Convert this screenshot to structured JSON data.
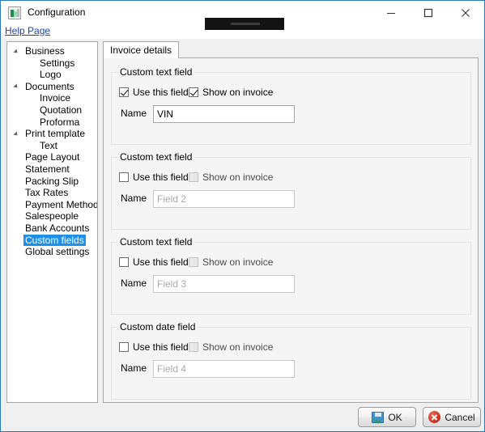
{
  "window": {
    "title": "Configuration",
    "icon": "app-image-icon",
    "border_color": "#2b79b7",
    "controls": {
      "minimize": "Minimize",
      "maximize": "Maximize",
      "close": "Close"
    },
    "redacted_region": true
  },
  "help": {
    "link_label": "Help Page",
    "link_color": "#1f3faa"
  },
  "sidebar": {
    "selection_color": "#1e90e8",
    "items": [
      {
        "label": "Business",
        "level": 0,
        "expander": true,
        "selected": false
      },
      {
        "label": "Settings",
        "level": 1,
        "expander": false,
        "selected": false
      },
      {
        "label": "Logo",
        "level": 1,
        "expander": false,
        "selected": false
      },
      {
        "label": "Documents",
        "level": 0,
        "expander": true,
        "selected": false
      },
      {
        "label": "Invoice",
        "level": 1,
        "expander": false,
        "selected": false
      },
      {
        "label": "Quotation",
        "level": 1,
        "expander": false,
        "selected": false
      },
      {
        "label": "Proforma",
        "level": 1,
        "expander": false,
        "selected": false
      },
      {
        "label": "Print template",
        "level": 0,
        "expander": true,
        "selected": false
      },
      {
        "label": "Text",
        "level": 1,
        "expander": false,
        "selected": false
      },
      {
        "label": "Page Layout",
        "level": 0,
        "expander": false,
        "selected": false
      },
      {
        "label": "Statement",
        "level": 0,
        "expander": false,
        "selected": false
      },
      {
        "label": "Packing Slip",
        "level": 0,
        "expander": false,
        "selected": false
      },
      {
        "label": "Tax Rates",
        "level": 0,
        "expander": false,
        "selected": false
      },
      {
        "label": "Payment Methods",
        "level": 0,
        "expander": false,
        "selected": false
      },
      {
        "label": "Salespeople",
        "level": 0,
        "expander": false,
        "selected": false
      },
      {
        "label": "Bank Accounts",
        "level": 0,
        "expander": false,
        "selected": false
      },
      {
        "label": "Custom fields",
        "level": 0,
        "expander": false,
        "selected": true
      },
      {
        "label": "Global settings",
        "level": 0,
        "expander": false,
        "selected": false
      }
    ]
  },
  "tabs": [
    {
      "label": "Invoice details",
      "selected": true
    }
  ],
  "groups": [
    {
      "title": "Custom text field",
      "use_field": {
        "label": "Use this field",
        "checked": true,
        "enabled": true
      },
      "show_on_invoice": {
        "label": "Show on invoice",
        "checked": true,
        "enabled": true
      },
      "name_label": "Name",
      "name_value": "VIN",
      "name_placeholder": ""
    },
    {
      "title": "Custom text field",
      "use_field": {
        "label": "Use this field",
        "checked": false,
        "enabled": true
      },
      "show_on_invoice": {
        "label": "Show on invoice",
        "checked": false,
        "enabled": false
      },
      "name_label": "Name",
      "name_value": "",
      "name_placeholder": "Field 2"
    },
    {
      "title": "Custom text field",
      "use_field": {
        "label": "Use this field",
        "checked": false,
        "enabled": true
      },
      "show_on_invoice": {
        "label": "Show on invoice",
        "checked": false,
        "enabled": false
      },
      "name_label": "Name",
      "name_value": "",
      "name_placeholder": "Field 3"
    },
    {
      "title": "Custom date field",
      "use_field": {
        "label": "Use this field",
        "checked": false,
        "enabled": true
      },
      "show_on_invoice": {
        "label": "Show on invoice",
        "checked": false,
        "enabled": false
      },
      "name_label": "Name",
      "name_value": "",
      "name_placeholder": "Field 4"
    }
  ],
  "footer": {
    "ok_label": "OK",
    "ok_icon": "save-disk-icon",
    "cancel_label": "Cancel",
    "cancel_icon": "cancel-circle-icon"
  }
}
